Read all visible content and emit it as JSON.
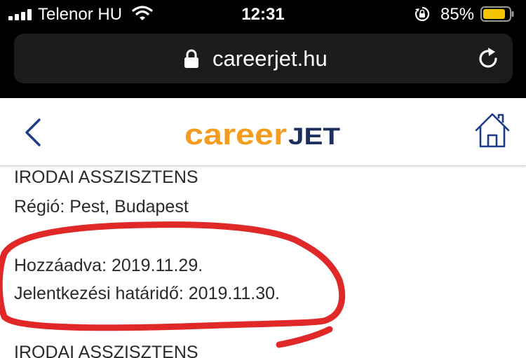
{
  "status_bar": {
    "carrier": "Telenor HU",
    "time": "12:31",
    "battery_percent": "85%",
    "battery_level": 0.85,
    "battery_color": "#f5c400"
  },
  "browser": {
    "url": "careerjet.hu",
    "lock_icon": "lock-icon",
    "reload_icon": "reload-icon"
  },
  "header": {
    "logo_part1": "career",
    "logo_part2": "JET",
    "logo_color1": "#f39c1e",
    "logo_color2": "#1c2f5e",
    "back_icon": "chevron-left-icon",
    "home_icon": "home-icon"
  },
  "jobs": [
    {
      "title": "IRODAI ASSZISZTENS",
      "region": "Régió: Pest, Budapest",
      "added": "Hozzáadva: 2019.11.29.",
      "deadline": "Jelentkezési határidő: 2019.11.30."
    },
    {
      "title": "IRODAI ASSZISZTENS"
    }
  ],
  "annotation": {
    "color": "#e02828",
    "shape": "hand-drawn circle"
  }
}
